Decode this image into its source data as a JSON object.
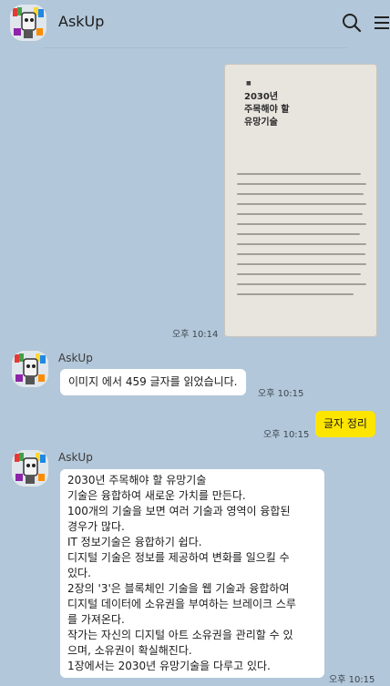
{
  "header": {
    "title": "AskUp",
    "search_icon": "search-icon",
    "menu_icon": "menu-icon"
  },
  "image_message": {
    "heading_line1": "2030년",
    "heading_line2": "주목해야 할",
    "heading_line3": "유망기술",
    "time": "오후 10:14"
  },
  "messages": [
    {
      "sender": "AskUp",
      "text": "이미지 에서 459 글자를 읽었습니다.",
      "time": "오후 10:15"
    },
    {
      "mine": true,
      "text": "글자 정리",
      "time": "오후 10:15"
    },
    {
      "sender": "AskUp",
      "lines": [
        "2030년 주목해야 할 유망기술",
        "기술은 융합하여 새로운 가치를 만든다.",
        "100개의 기술을 보면 여러 기술과 영역이 융합된",
        "경우가 많다.",
        "IT 정보기술은 융합하기 쉽다.",
        "디지털 기술은 정보를 제공하여 변화를 일으킬 수",
        "있다.",
        "2장의 '3'은 블록체인 기술을 웹 기술과 융합하여",
        "디지털 데이터에 소유권을 부여하는 브레이크 스루",
        "를 가져온다.",
        "작가는 자신의 디지털 아트 소유권을 관리할 수 있",
        "으며, 소유권이 확실해진다.",
        "1장에서는 2030년 유망기술을 다루고 있다."
      ],
      "time": "오후 10:15"
    }
  ],
  "colors": {
    "background": "#b2c7d9",
    "my_bubble": "#fee500",
    "their_bubble": "#ffffff"
  }
}
